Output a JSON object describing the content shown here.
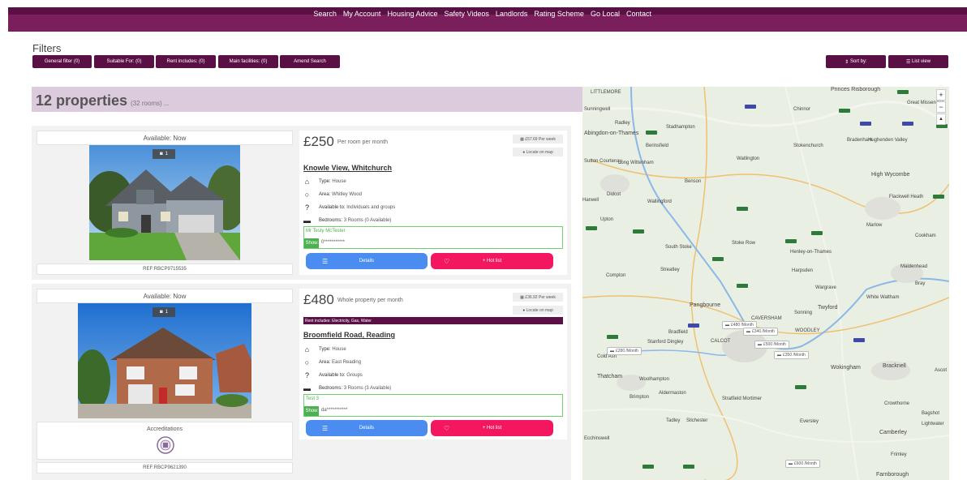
{
  "nav": [
    "Search",
    "My Account",
    "Housing Advice",
    "Safety Videos",
    "Landlords",
    "Rating Scheme",
    "Go Local",
    "Contact"
  ],
  "filters": {
    "title": "Filters",
    "buttons": [
      "General filter (0)",
      "Suitable For: (0)",
      "Rent includes: (0)",
      "Main facilities: (0)",
      "Amend Search"
    ],
    "sort_label": "Sort by:",
    "list_view_label": "List view"
  },
  "results": {
    "count": "12 properties",
    "rooms": "(32 rooms) ..."
  },
  "properties": [
    {
      "availability": "Available: Now",
      "photo_count": "1",
      "ref": "REF:RBCP9715535",
      "price": "£250",
      "price_basis": "Per room per month",
      "price_week": "£57.69 Per week",
      "locate": "Locate on map",
      "title": "Knowle View, Whitchurch",
      "type_label": "Type:",
      "type_value": "House",
      "area_label": "Area:",
      "area_value": "Whitley Wood",
      "available_to_label": "Available to:",
      "available_to_value": "Individuals and groups",
      "bedrooms_label": "Bedrooms:",
      "bedrooms_value": "3 Rooms (0 Available)",
      "contact_name": "Mr Testy McTester",
      "show_label": "Show",
      "contact_masked": "0***********",
      "details_label": "Details",
      "hotlist_label": "+ Hot list"
    },
    {
      "availability": "Available: Now",
      "photo_count": "1",
      "ref": "REF:RBCP9621390",
      "accreditations_label": "Accreditations",
      "price": "£480",
      "price_basis": "Whole property per month",
      "price_week": "£36.92 Per week",
      "locate": "Locate on map",
      "rent_includes": "Rent includes: Electricity, Gas, Water",
      "title": "Broomfield Road, Reading",
      "type_label": "Type:",
      "type_value": "House",
      "area_label": "Area:",
      "area_value": "East Reading",
      "available_to_label": "Available to:",
      "available_to_value": "Groups",
      "bedrooms_label": "Bedrooms:",
      "bedrooms_value": "3 Rooms (3 Available)",
      "contact_name": "Test 3",
      "show_label": "Show",
      "contact_masked": "da***********",
      "details_label": "Details",
      "hotlist_label": "+ Hot list"
    }
  ],
  "map": {
    "places": [
      "LITTLEMORE",
      "Sunningwell",
      "Radley",
      "Stadhampton",
      "Chinnor",
      "Princes Risborough",
      "Great Missenden",
      "Abingdon-on-Thames",
      "Berinsfield",
      "Stokenchurch",
      "Bradenham",
      "Hughenden Valley",
      "Sutton Courtenay",
      "Long Wittenham",
      "Watlington",
      "High Wycombe",
      "Didcot",
      "Harwell",
      "Benson",
      "Wallingford",
      "Flackwell Heath",
      "Upton",
      "Marlow",
      "Cookham",
      "South Stoke",
      "Stoke Row",
      "Henley-on-Thames",
      "Harpsden",
      "Maidenhead",
      "Streatley",
      "Compton",
      "Wargrave",
      "Bray",
      "White Waltham",
      "Pangbourne",
      "Twyford",
      "Bradfield",
      "Sonning",
      "Stanford Dingley",
      "WOODLEY",
      "Cold Ash",
      "Thatcham",
      "Wokingham",
      "Bracknell",
      "Ascot",
      "Woolhampton",
      "Brimpton",
      "Aldermaston",
      "Stratfield Mortimer",
      "Crowthorne",
      "Bagshot",
      "Lightwater",
      "Tadley",
      "Silchester",
      "Eversley",
      "Camberley",
      "Frimley",
      "Farnborough",
      "Ecchinswell",
      "CAVERSHAM",
      "CALCOT"
    ],
    "pins": [
      "£480 /Month",
      "£340 /Month",
      "£500 /Month",
      "£350 /Month",
      "£280 /Month",
      "£600 /Month"
    ],
    "zoom_in": "+",
    "zoom_out": "−",
    "north": "▲"
  }
}
